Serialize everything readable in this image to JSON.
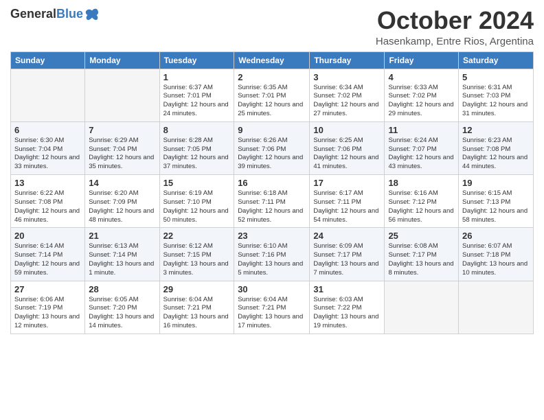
{
  "header": {
    "logo_general": "General",
    "logo_blue": "Blue",
    "main_title": "October 2024",
    "subtitle": "Hasenkamp, Entre Rios, Argentina"
  },
  "calendar": {
    "days_of_week": [
      "Sunday",
      "Monday",
      "Tuesday",
      "Wednesday",
      "Thursday",
      "Friday",
      "Saturday"
    ],
    "weeks": [
      [
        {
          "day": "",
          "info": ""
        },
        {
          "day": "",
          "info": ""
        },
        {
          "day": "1",
          "info": "Sunrise: 6:37 AM\nSunset: 7:01 PM\nDaylight: 12 hours and 24 minutes."
        },
        {
          "day": "2",
          "info": "Sunrise: 6:35 AM\nSunset: 7:01 PM\nDaylight: 12 hours and 25 minutes."
        },
        {
          "day": "3",
          "info": "Sunrise: 6:34 AM\nSunset: 7:02 PM\nDaylight: 12 hours and 27 minutes."
        },
        {
          "day": "4",
          "info": "Sunrise: 6:33 AM\nSunset: 7:02 PM\nDaylight: 12 hours and 29 minutes."
        },
        {
          "day": "5",
          "info": "Sunrise: 6:31 AM\nSunset: 7:03 PM\nDaylight: 12 hours and 31 minutes."
        }
      ],
      [
        {
          "day": "6",
          "info": "Sunrise: 6:30 AM\nSunset: 7:04 PM\nDaylight: 12 hours and 33 minutes."
        },
        {
          "day": "7",
          "info": "Sunrise: 6:29 AM\nSunset: 7:04 PM\nDaylight: 12 hours and 35 minutes."
        },
        {
          "day": "8",
          "info": "Sunrise: 6:28 AM\nSunset: 7:05 PM\nDaylight: 12 hours and 37 minutes."
        },
        {
          "day": "9",
          "info": "Sunrise: 6:26 AM\nSunset: 7:06 PM\nDaylight: 12 hours and 39 minutes."
        },
        {
          "day": "10",
          "info": "Sunrise: 6:25 AM\nSunset: 7:06 PM\nDaylight: 12 hours and 41 minutes."
        },
        {
          "day": "11",
          "info": "Sunrise: 6:24 AM\nSunset: 7:07 PM\nDaylight: 12 hours and 43 minutes."
        },
        {
          "day": "12",
          "info": "Sunrise: 6:23 AM\nSunset: 7:08 PM\nDaylight: 12 hours and 44 minutes."
        }
      ],
      [
        {
          "day": "13",
          "info": "Sunrise: 6:22 AM\nSunset: 7:08 PM\nDaylight: 12 hours and 46 minutes."
        },
        {
          "day": "14",
          "info": "Sunrise: 6:20 AM\nSunset: 7:09 PM\nDaylight: 12 hours and 48 minutes."
        },
        {
          "day": "15",
          "info": "Sunrise: 6:19 AM\nSunset: 7:10 PM\nDaylight: 12 hours and 50 minutes."
        },
        {
          "day": "16",
          "info": "Sunrise: 6:18 AM\nSunset: 7:11 PM\nDaylight: 12 hours and 52 minutes."
        },
        {
          "day": "17",
          "info": "Sunrise: 6:17 AM\nSunset: 7:11 PM\nDaylight: 12 hours and 54 minutes."
        },
        {
          "day": "18",
          "info": "Sunrise: 6:16 AM\nSunset: 7:12 PM\nDaylight: 12 hours and 56 minutes."
        },
        {
          "day": "19",
          "info": "Sunrise: 6:15 AM\nSunset: 7:13 PM\nDaylight: 12 hours and 58 minutes."
        }
      ],
      [
        {
          "day": "20",
          "info": "Sunrise: 6:14 AM\nSunset: 7:14 PM\nDaylight: 12 hours and 59 minutes."
        },
        {
          "day": "21",
          "info": "Sunrise: 6:13 AM\nSunset: 7:14 PM\nDaylight: 13 hours and 1 minute."
        },
        {
          "day": "22",
          "info": "Sunrise: 6:12 AM\nSunset: 7:15 PM\nDaylight: 13 hours and 3 minutes."
        },
        {
          "day": "23",
          "info": "Sunrise: 6:10 AM\nSunset: 7:16 PM\nDaylight: 13 hours and 5 minutes."
        },
        {
          "day": "24",
          "info": "Sunrise: 6:09 AM\nSunset: 7:17 PM\nDaylight: 13 hours and 7 minutes."
        },
        {
          "day": "25",
          "info": "Sunrise: 6:08 AM\nSunset: 7:17 PM\nDaylight: 13 hours and 8 minutes."
        },
        {
          "day": "26",
          "info": "Sunrise: 6:07 AM\nSunset: 7:18 PM\nDaylight: 13 hours and 10 minutes."
        }
      ],
      [
        {
          "day": "27",
          "info": "Sunrise: 6:06 AM\nSunset: 7:19 PM\nDaylight: 13 hours and 12 minutes."
        },
        {
          "day": "28",
          "info": "Sunrise: 6:05 AM\nSunset: 7:20 PM\nDaylight: 13 hours and 14 minutes."
        },
        {
          "day": "29",
          "info": "Sunrise: 6:04 AM\nSunset: 7:21 PM\nDaylight: 13 hours and 16 minutes."
        },
        {
          "day": "30",
          "info": "Sunrise: 6:04 AM\nSunset: 7:21 PM\nDaylight: 13 hours and 17 minutes."
        },
        {
          "day": "31",
          "info": "Sunrise: 6:03 AM\nSunset: 7:22 PM\nDaylight: 13 hours and 19 minutes."
        },
        {
          "day": "",
          "info": ""
        },
        {
          "day": "",
          "info": ""
        }
      ]
    ]
  }
}
